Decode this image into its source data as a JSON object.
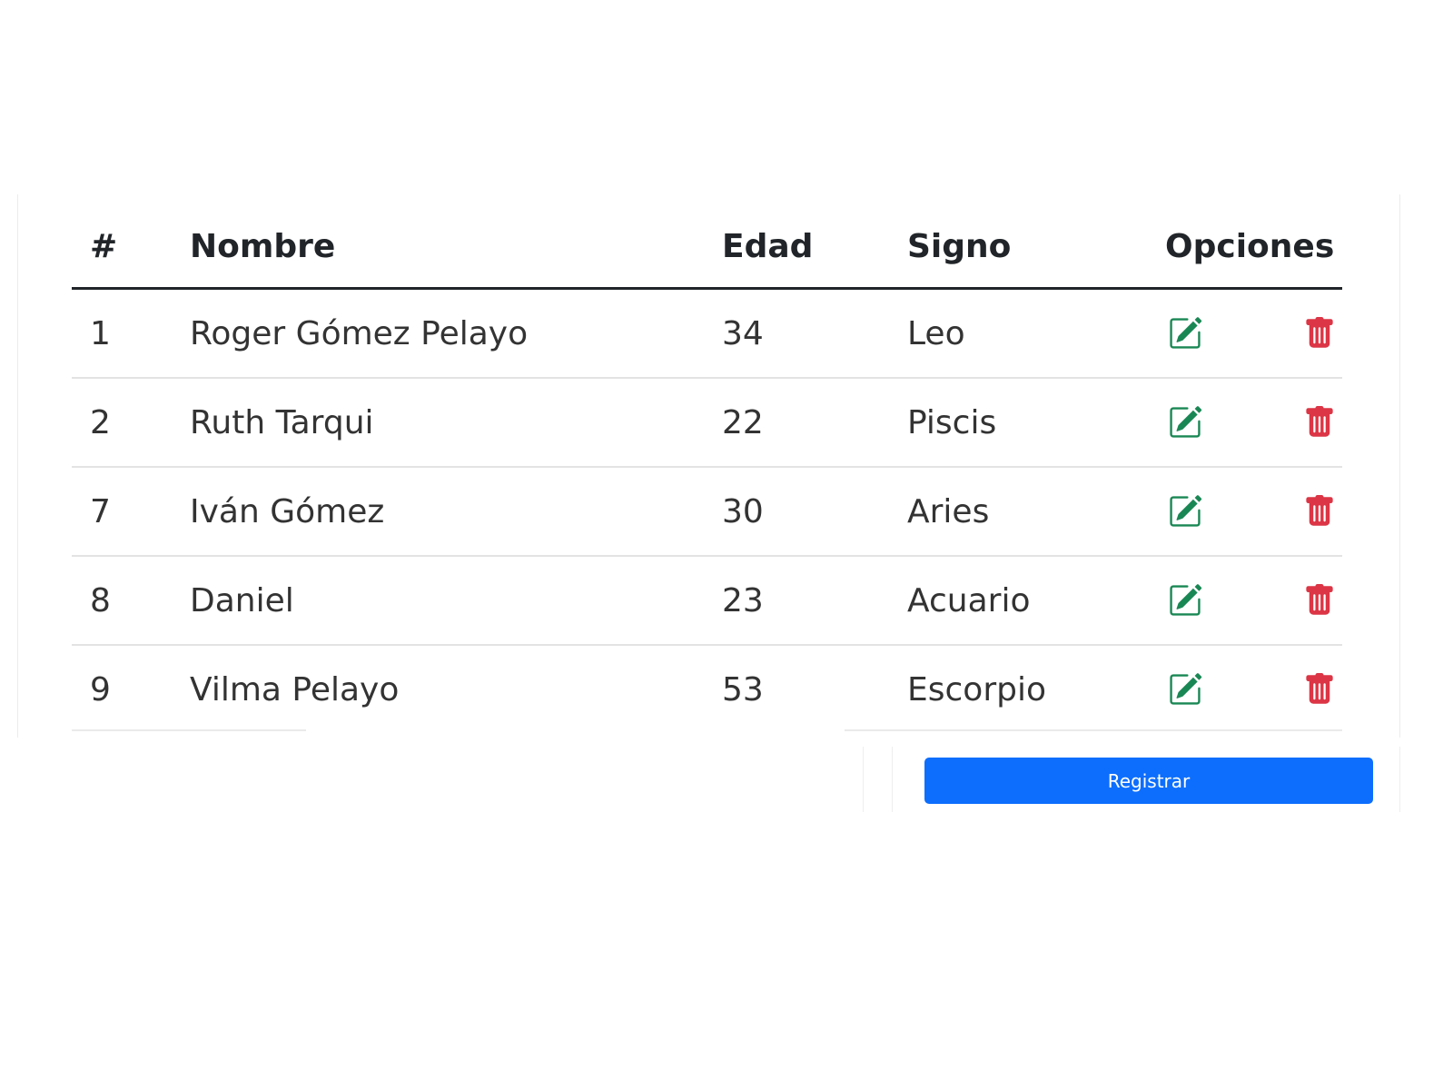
{
  "table": {
    "headers": {
      "num": "#",
      "name": "Nombre",
      "age": "Edad",
      "sign": "Signo",
      "options": "Opciones"
    },
    "rows": [
      {
        "id": "1",
        "name": "Roger Gómez Pelayo",
        "age": "34",
        "sign": "Leo"
      },
      {
        "id": "2",
        "name": "Ruth Tarqui",
        "age": "22",
        "sign": "Piscis"
      },
      {
        "id": "7",
        "name": "Iván Gómez",
        "age": "30",
        "sign": "Aries"
      },
      {
        "id": "8",
        "name": "Daniel",
        "age": "23",
        "sign": "Acuario"
      },
      {
        "id": "9",
        "name": "Vilma Pelayo",
        "age": "53",
        "sign": "Escorpio"
      }
    ],
    "row_actions": [
      {
        "icon": "edit-icon",
        "color": "#198754"
      },
      {
        "icon": "trash-icon",
        "color": "#dc3545"
      }
    ]
  },
  "form": {
    "submit_label": "Registrar",
    "button_color": "#0d6efd"
  }
}
